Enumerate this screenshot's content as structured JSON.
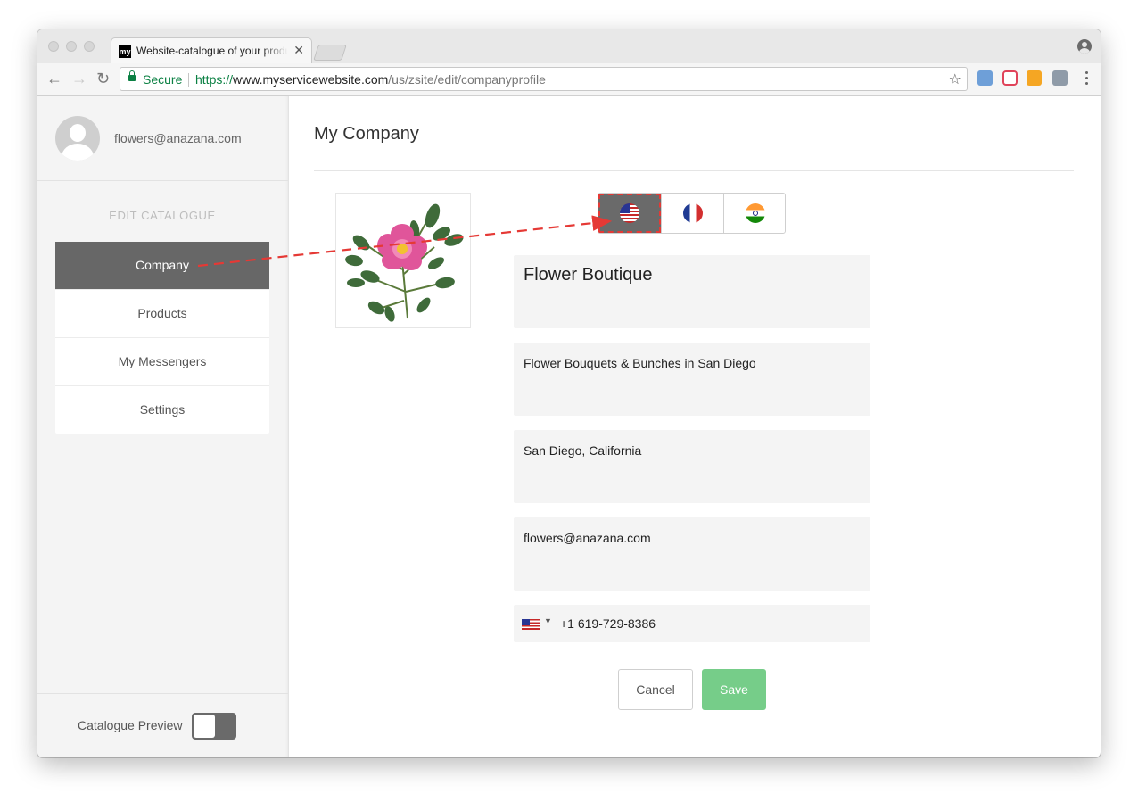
{
  "browser": {
    "tab_favicon": "my",
    "tab_title": "Website-catalogue of your products",
    "tab_close": "✕",
    "secure_label": "Secure",
    "url_protocol": "https://",
    "url_host": "www.myservicewebsite.com",
    "url_path": "/us/zsite/edit/companyprofile",
    "nav_back": "←",
    "nav_forward": "→",
    "nav_reload": "↻",
    "bookmark_star": "☆",
    "extension_colors": [
      "#6e9fd8",
      "#e0435a",
      "#f5a623",
      "#8f9ba8"
    ]
  },
  "sidebar": {
    "user_email": "flowers@anazana.com",
    "section_title": "EDIT CATALOGUE",
    "items": [
      {
        "label": "Company",
        "active": true
      },
      {
        "label": "Products",
        "active": false
      },
      {
        "label": "My Messengers",
        "active": false
      },
      {
        "label": "Settings",
        "active": false
      }
    ],
    "preview_label": "Catalogue Preview",
    "preview_enabled": false
  },
  "main": {
    "title": "My Company",
    "languages": [
      {
        "flag": "us-flag-icon",
        "selected": true
      },
      {
        "flag": "france-flag-icon",
        "selected": false
      },
      {
        "flag": "india-flag-icon",
        "selected": false
      }
    ],
    "company_name": "Flower Boutique",
    "description": "Flower Bouquets & Bunches in San Diego",
    "location": "San Diego, California",
    "email": "flowers@anazana.com",
    "phone_caret": "▼",
    "phone": "+1 619-729-8386",
    "cancel_label": "Cancel",
    "save_label": "Save"
  },
  "colors": {
    "active_menu": "#676767",
    "save_button": "#76cd89",
    "secure_green": "#0b8043",
    "annotation_red": "#e53935"
  }
}
